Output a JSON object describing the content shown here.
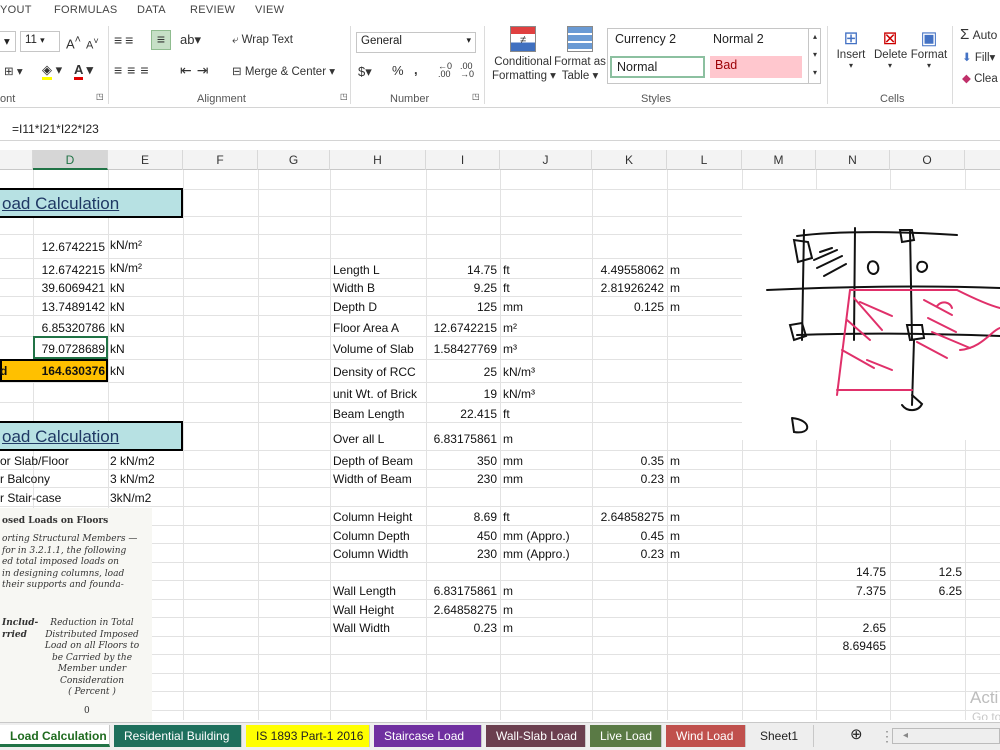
{
  "ribbon_tabs": [
    "YOUT",
    "FORMULAS",
    "DATA",
    "REVIEW",
    "VIEW"
  ],
  "ribbon": {
    "font_size": "11",
    "font_group": "ont",
    "wrap_text": "Wrap Text",
    "merge_center": "Merge & Center",
    "alignment_group": "Alignment",
    "number_format": "General",
    "number_group": "Number",
    "conditional_1": "Conditional",
    "conditional_2": "Formatting",
    "format_as_1": "Format as",
    "format_as_2": "Table",
    "styles": {
      "currency2": "Currency 2",
      "normal2": "Normal 2",
      "normal": "Normal",
      "bad": "Bad"
    },
    "styles_group": "Styles",
    "insert": "Insert",
    "delete": "Delete",
    "format": "Format",
    "cells_group": "Cells",
    "autosum": "Auto",
    "fill": "Fill",
    "clear": "Clea"
  },
  "formula": "=I11*I21*I22*I23",
  "columns": [
    "D",
    "E",
    "F",
    "G",
    "H",
    "I",
    "J",
    "K",
    "L",
    "M",
    "N",
    "O"
  ],
  "titles": {
    "slab": "oad Calculation",
    "live": "oad Calculation"
  },
  "left": {
    "d1": "12.6742215",
    "u1": "kN/m²",
    "d2": "12.6742215",
    "u2": "kN/m²",
    "d3": "39.6069421",
    "u3": "kN",
    "d4": "13.7489142",
    "u4": "kN",
    "d5": "6.85320786",
    "u5": "kN",
    "d6": "79.0728689",
    "u6": "kN",
    "total_label": "d",
    "total": "164.630376",
    "ut": "kN"
  },
  "live": [
    {
      "label": "or Slab/Floor",
      "value": "2  kN/m2"
    },
    {
      "label": "r Balcony",
      "value": "3 kN/m2"
    },
    {
      "label": "r Stair-case",
      "value": "3kN/m2"
    }
  ],
  "table": [
    {
      "label": "Length   L",
      "i": "14.75",
      "j": "ft",
      "k": "4.49558062",
      "l": "m"
    },
    {
      "label": "Width    B",
      "i": "9.25",
      "j": "ft",
      "k": "2.81926242",
      "l": "m"
    },
    {
      "label": "Depth   D",
      "i": "125",
      "j": "mm",
      "k": "0.125",
      "l": "m"
    },
    {
      "label": "Floor Area  A",
      "i": "12.6742215",
      "j": "m²",
      "k": "",
      "l": ""
    },
    {
      "label": "Volume of Slab",
      "i": "1.58427769",
      "j": "m³",
      "k": "",
      "l": ""
    },
    {
      "label": "Density of RCC",
      "i": "25",
      "j": "kN/m³",
      "k": "",
      "l": ""
    },
    {
      "label": "unit Wt. of Brick",
      "i": "19",
      "j": "kN/m³",
      "k": "",
      "l": ""
    },
    {
      "label": "Beam Length",
      "i": "22.415",
      "j": "ft",
      "k": "",
      "l": ""
    },
    {
      "label": "Over all L",
      "i": "6.83175861",
      "j": "m",
      "k": "",
      "l": ""
    },
    {
      "label": "Depth of Beam",
      "i": "350",
      "j": "mm",
      "k": "0.35",
      "l": "m"
    },
    {
      "label": "Width of Beam",
      "i": "230",
      "j": "mm",
      "k": "0.23",
      "l": "m"
    },
    {
      "label": "Column Height",
      "i": "8.69",
      "j": "ft",
      "k": "2.64858275",
      "l": "m"
    },
    {
      "label": "Column Depth",
      "i": "450",
      "j": "mm (Appro.)",
      "k": "0.45",
      "l": "m"
    },
    {
      "label": "Column Width",
      "i": "230",
      "j": "mm (Appro.)",
      "k": "0.23",
      "l": "m"
    },
    {
      "label": "Wall Length",
      "i": "6.83175861",
      "j": "m",
      "k": "",
      "l": ""
    },
    {
      "label": "Wall Height",
      "i": "2.64858275",
      "j": "m",
      "k": "",
      "l": ""
    },
    {
      "label": "Wall Width",
      "i": "0.23",
      "j": "m",
      "k": "",
      "l": ""
    }
  ],
  "nvals": {
    "n1": "14.75",
    "o1": "12.5",
    "n2": "7.375",
    "o2": "6.25",
    "n3": "2.65",
    "n4": "8.69465"
  },
  "excerpt": {
    "heading": "osed Loads on Floors",
    "lines": [
      "orting Structural Members —",
      "for in 3.2.1.1, the following",
      "ed total imposed loads on",
      "in designing columns, load",
      "their supports and founda-"
    ],
    "col_a": [
      "Includ-",
      "rried"
    ],
    "col_b": [
      "Reduction in Total",
      "Distributed Imposed",
      "Load on all Floors to",
      "be Carried by the",
      "Member under",
      "Consideration",
      "( Percent )"
    ],
    "zero": "0"
  },
  "activate": [
    "Acti",
    "Go to"
  ],
  "sheet_tabs": [
    {
      "label": "Load Calculation",
      "bg": "#ffffff",
      "fg": "#1f6b1f"
    },
    {
      "label": "Residential Building",
      "bg": "#1e6f5c",
      "fg": "#ffffff"
    },
    {
      "label": "IS 1893 Part-1 2016",
      "bg": "#ffff00",
      "fg": "#222222"
    },
    {
      "label": "Staircase Load",
      "bg": "#7030a0",
      "fg": "#ffffff"
    },
    {
      "label": "Wall-Slab Load",
      "bg": "#6b3f4f",
      "fg": "#ffffff"
    },
    {
      "label": "Live Load",
      "bg": "#5a7a45",
      "fg": "#ffffff"
    },
    {
      "label": "Wind Load",
      "bg": "#c0504d",
      "fg": "#ffffff"
    },
    {
      "label": "Sheet1",
      "bg": "#eeeeee",
      "fg": "#222222"
    }
  ],
  "colors": {
    "title_bg": "#b7e1e3",
    "total_bg": "#ffc000",
    "sketch_pink": "#e0306a"
  }
}
